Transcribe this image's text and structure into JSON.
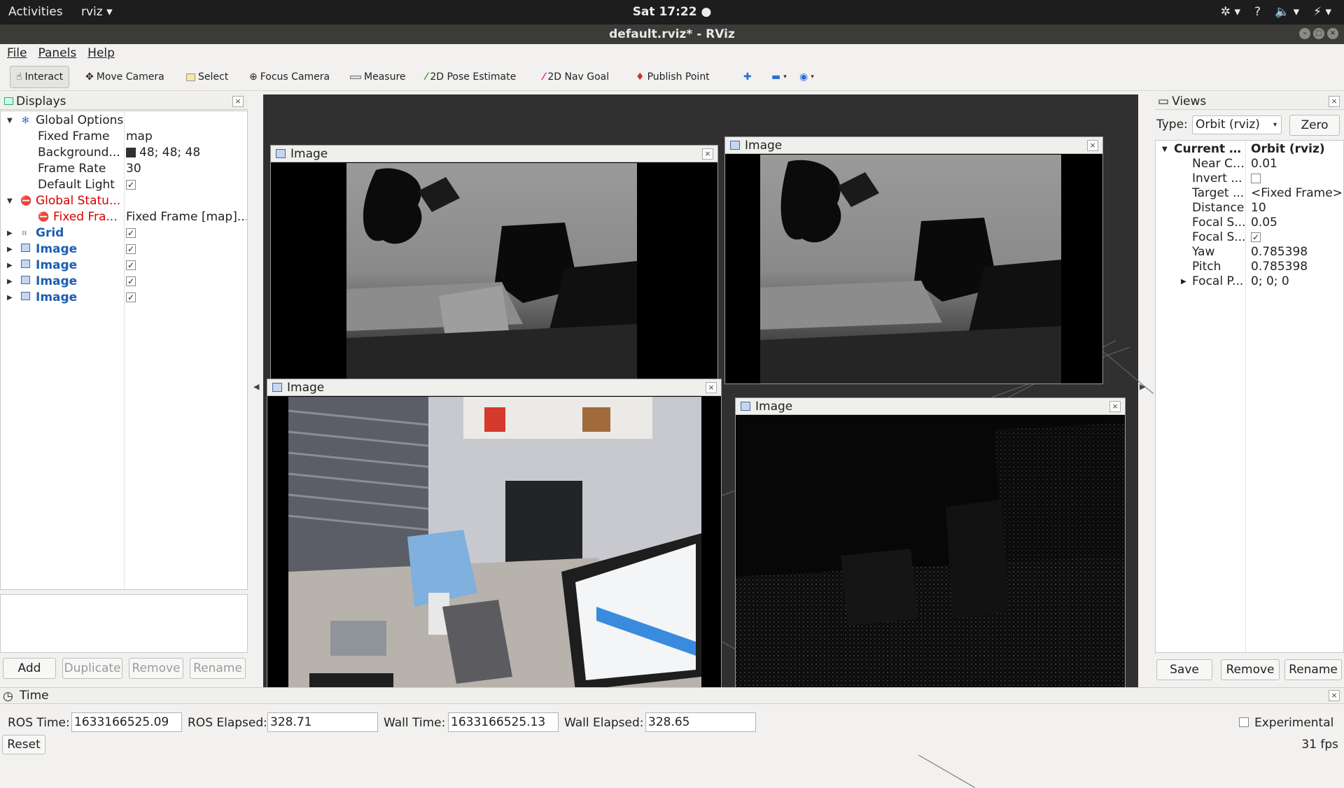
{
  "topbar": {
    "activities": "Activities",
    "app": "rviz",
    "app_arrow": "▾",
    "clock": "Sat 17:22 ●",
    "tray": [
      "✲ ▾",
      "?",
      "🔈 ▾",
      "⚡ ▾"
    ]
  },
  "window": {
    "title": "default.rviz* - RViz"
  },
  "menu": [
    "File",
    "Panels",
    "Help"
  ],
  "toolbar": [
    {
      "label": "Interact",
      "icon": "hand-icon"
    },
    {
      "label": "Move Camera",
      "icon": "move-icon"
    },
    {
      "label": "Select",
      "icon": "select-icon"
    },
    {
      "label": "Focus Camera",
      "icon": "focus-icon"
    },
    {
      "label": "Measure",
      "icon": "ruler-icon"
    },
    {
      "label": "2D Pose Estimate",
      "icon": "pose-arrow-icon"
    },
    {
      "label": "2D Nav Goal",
      "icon": "nav-arrow-icon"
    },
    {
      "label": "Publish Point",
      "icon": "pin-icon"
    }
  ],
  "displays": {
    "title": "Displays",
    "global_options": "Global Options",
    "fixed_frame_label": "Fixed Frame",
    "fixed_frame_value": "map",
    "background_label": "Background...",
    "background_value": "48; 48; 48",
    "background_color": "#303030",
    "frame_rate_label": "Frame Rate",
    "frame_rate_value": "30",
    "default_light_label": "Default Light",
    "default_light_checked": "✓",
    "global_status": "Global Statu...",
    "fixed_frame_status_label": "Fixed Fra...",
    "fixed_frame_status_value": "Fixed Frame [map]...",
    "items": [
      {
        "label": "Grid",
        "checked": "✓"
      },
      {
        "label": "Image",
        "checked": "✓"
      },
      {
        "label": "Image",
        "checked": "✓"
      },
      {
        "label": "Image",
        "checked": "✓"
      },
      {
        "label": "Image",
        "checked": "✓"
      }
    ],
    "buttons": {
      "add": "Add",
      "duplicate": "Duplicate",
      "remove": "Remove",
      "rename": "Rename"
    }
  },
  "image_windows": [
    {
      "title": "Image",
      "kind": "depth"
    },
    {
      "title": "Image",
      "kind": "depth"
    },
    {
      "title": "Image",
      "kind": "color"
    },
    {
      "title": "Image",
      "kind": "ir"
    }
  ],
  "views": {
    "title": "Views",
    "type_label": "Type:",
    "type_value": "Orbit (rviz)",
    "zero": "Zero",
    "current_label": "Current V...",
    "current_value": "Orbit (rviz)",
    "rows": [
      {
        "label": "Near Cl...",
        "value": "0.01"
      },
      {
        "label": "Invert ...",
        "value": ""
      },
      {
        "label": "Target ...",
        "value": "<Fixed Frame>"
      },
      {
        "label": "Distance",
        "value": "10"
      },
      {
        "label": "Focal S...",
        "value": "0.05"
      },
      {
        "label": "Focal S...",
        "value": "✓"
      },
      {
        "label": "Yaw",
        "value": "0.785398"
      },
      {
        "label": "Pitch",
        "value": "0.785398"
      },
      {
        "label": "Focal P...",
        "value": "0; 0; 0"
      }
    ],
    "buttons": {
      "save": "Save",
      "remove": "Remove",
      "rename": "Rename"
    }
  },
  "time": {
    "title": "Time",
    "ros_time_label": "ROS Time:",
    "ros_time": "1633166525.09",
    "ros_elapsed_label": "ROS Elapsed:",
    "ros_elapsed": "328.71",
    "wall_time_label": "Wall Time:",
    "wall_time": "1633166525.13",
    "wall_elapsed_label": "Wall Elapsed:",
    "wall_elapsed": "328.65",
    "experimental": "Experimental",
    "reset": "Reset",
    "fps": "31 fps"
  }
}
